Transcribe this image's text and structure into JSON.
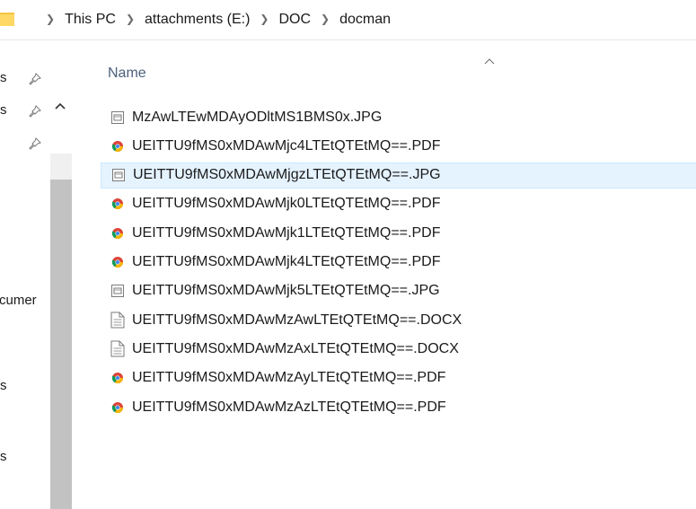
{
  "breadcrumb": [
    "This PC",
    "attachments (E:)",
    "DOC",
    "docman"
  ],
  "nav": {
    "items": [
      {
        "label": "s",
        "pinned": true
      },
      {
        "label": "s",
        "pinned": true
      },
      {
        "label": "",
        "pinned": true
      },
      {
        "label": "cumer",
        "pinned": false
      },
      {
        "label": "s",
        "pinned": false
      },
      {
        "label": "s",
        "pinned": false
      }
    ]
  },
  "columns": {
    "name": "Name"
  },
  "files": [
    {
      "name": "MzAwLTEwMDAyODltMS1BMS0x.JPG",
      "type": "image",
      "selected": false
    },
    {
      "name": "UEITTU9fMS0xMDAwMjc4LTEtQTEtMQ==.PDF",
      "type": "pdf",
      "selected": false
    },
    {
      "name": "UEITTU9fMS0xMDAwMjgzLTEtQTEtMQ==.JPG",
      "type": "image",
      "selected": true
    },
    {
      "name": "UEITTU9fMS0xMDAwMjk0LTEtQTEtMQ==.PDF",
      "type": "pdf",
      "selected": false
    },
    {
      "name": "UEITTU9fMS0xMDAwMjk1LTEtQTEtMQ==.PDF",
      "type": "pdf",
      "selected": false
    },
    {
      "name": "UEITTU9fMS0xMDAwMjk4LTEtQTEtMQ==.PDF",
      "type": "pdf",
      "selected": false
    },
    {
      "name": "UEITTU9fMS0xMDAwMjk5LTEtQTEtMQ==.JPG",
      "type": "image",
      "selected": false
    },
    {
      "name": "UEITTU9fMS0xMDAwMzAwLTEtQTEtMQ==.DOCX",
      "type": "docx",
      "selected": false
    },
    {
      "name": "UEITTU9fMS0xMDAwMzAxLTEtQTEtMQ==.DOCX",
      "type": "docx",
      "selected": false
    },
    {
      "name": "UEITTU9fMS0xMDAwMzAyLTEtQTEtMQ==.PDF",
      "type": "pdf",
      "selected": false
    },
    {
      "name": "UEITTU9fMS0xMDAwMzAzLTEtQTEtMQ==.PDF",
      "type": "pdf",
      "selected": false
    }
  ],
  "colors": {
    "selection_bg": "#e5f3ff",
    "selection_border": "#cce8ff",
    "header_text": "#4c607a"
  }
}
